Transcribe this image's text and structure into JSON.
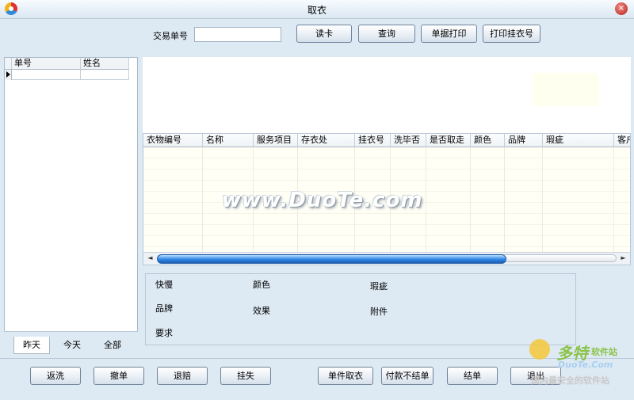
{
  "window": {
    "title": "取衣"
  },
  "top": {
    "trade_no_label": "交易单号",
    "trade_no_value": "",
    "btn_read_card": "读卡",
    "btn_query": "查询",
    "btn_print_receipt": "单据打印",
    "btn_print_hanger": "打印挂衣号"
  },
  "order_list": {
    "headers": [
      "单号",
      "姓名"
    ],
    "tabs": [
      "昨天",
      "今天",
      "全部"
    ],
    "active_tab": "昨天"
  },
  "items_grid": {
    "headers": [
      "衣物编号",
      "名称",
      "服务项目",
      "存衣处",
      "挂衣号",
      "洗毕否",
      "是否取走",
      "颜色",
      "品牌",
      "瑕疵",
      "客户"
    ]
  },
  "attributes": {
    "speed": "快慢",
    "color": "颜色",
    "defect": "瑕疵",
    "brand": "品牌",
    "effect": "效果",
    "accessory": "附件",
    "requirement": "要求"
  },
  "bottom": {
    "btn_rewash": "返洗",
    "btn_cancel": "撤单",
    "btn_refund": "退赔",
    "btn_lost": "挂失",
    "btn_single_pickup": "单件取衣",
    "btn_pay_no_settle": "付款不结单",
    "btn_settle": "结单",
    "btn_exit": "退出"
  },
  "watermark": {
    "text": "www.DuoTe.com",
    "logo_cn": "多特",
    "logo_soft": "软件站",
    "logo_domain": "DuoTe.Com",
    "logo_sub": "国内最安全的软件站"
  }
}
